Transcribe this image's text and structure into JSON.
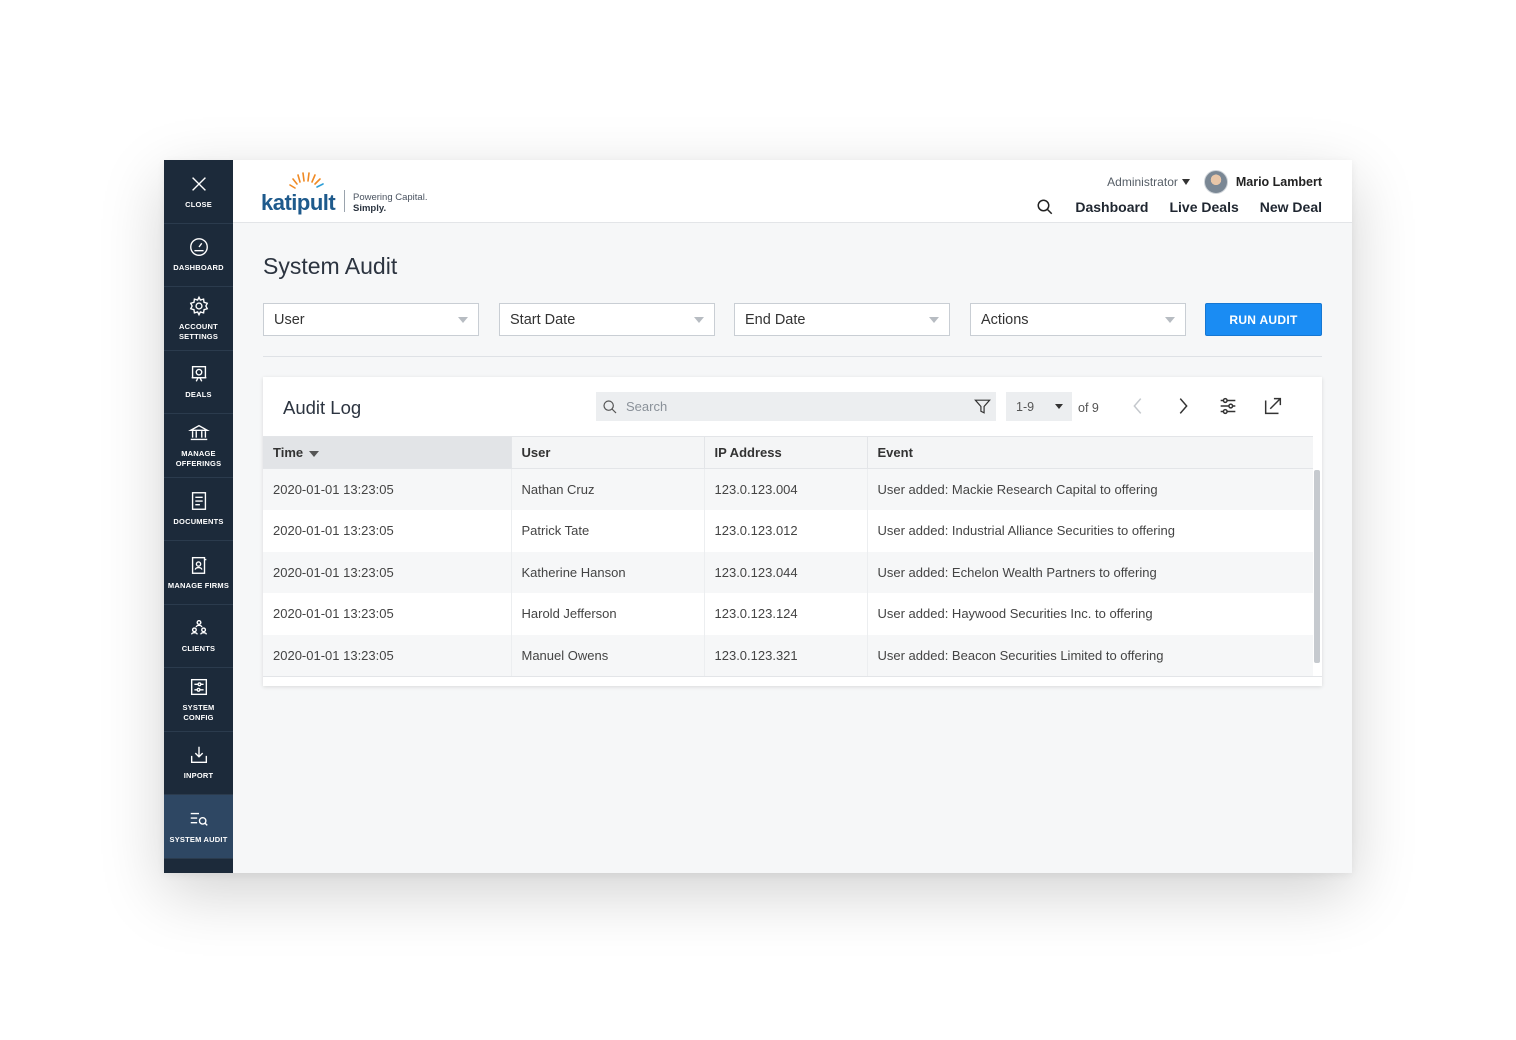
{
  "sidebar": {
    "items": [
      {
        "label": "Close",
        "icon": "close-icon"
      },
      {
        "label": "Dashboard",
        "icon": "gauge-icon"
      },
      {
        "label": "Account Settings",
        "icon": "gear-icon"
      },
      {
        "label": "Deals",
        "icon": "presentation-board-icon"
      },
      {
        "label": "Manage Offerings",
        "icon": "bank-icon"
      },
      {
        "label": "Documents",
        "icon": "document-icon"
      },
      {
        "label": "Manage Firms",
        "icon": "contact-card-icon"
      },
      {
        "label": "Clients",
        "icon": "people-icon"
      },
      {
        "label": "System Config",
        "icon": "config-panel-icon"
      },
      {
        "label": "Inport",
        "icon": "import-tray-icon"
      },
      {
        "label": "System Audit",
        "icon": "audit-search-icon",
        "active": true
      }
    ]
  },
  "header": {
    "logo": {
      "wordmark": "katipult",
      "tagline_1": "Powering Capital.",
      "tagline_2": "Simply."
    },
    "role": "Administrator",
    "user_name": "Mario Lambert",
    "nav": [
      "Dashboard",
      "Live Deals",
      "New Deal"
    ]
  },
  "page": {
    "title": "System Audit",
    "filters": [
      "User",
      "Start Date",
      "End Date",
      "Actions"
    ],
    "run_button": "RUN AUDIT"
  },
  "audit_log": {
    "title": "Audit Log",
    "search_placeholder": "Search",
    "page_range": "1-9",
    "page_of": "of 9",
    "columns": [
      "Time",
      "User",
      "IP Address",
      "Event"
    ],
    "sorted_column": "Time",
    "rows": [
      {
        "time": "2020-01-01 13:23:05",
        "user": "Nathan Cruz",
        "ip": "123.0.123.004",
        "event": "User added: Mackie Research Capital to offering"
      },
      {
        "time": "2020-01-01 13:23:05",
        "user": "Patrick Tate",
        "ip": "123.0.123.012",
        "event": "User added: Industrial Alliance Securities to offering"
      },
      {
        "time": "2020-01-01 13:23:05",
        "user": "Katherine Hanson",
        "ip": "123.0.123.044",
        "event": "User added: Echelon Wealth Partners to offering"
      },
      {
        "time": "2020-01-01 13:23:05",
        "user": "Harold Jefferson",
        "ip": "123.0.123.124",
        "event": "User added: Haywood Securities Inc. to offering"
      },
      {
        "time": "2020-01-01 13:23:05",
        "user": "Manuel Owens",
        "ip": "123.0.123.321",
        "event": "User added: Beacon Securities Limited to offering"
      }
    ]
  },
  "colors": {
    "sidebar_bg": "#1c2a3a",
    "sidebar_active": "#2e4763",
    "accent_blue": "#1a8cf3",
    "logo_blue": "#1e5a8c",
    "logo_orange": "#f08a24"
  }
}
